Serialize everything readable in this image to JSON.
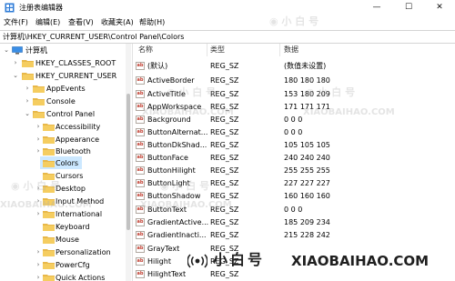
{
  "window": {
    "title": "注册表编辑器",
    "app_icon": "registry-editor-icon",
    "minimize_glyph": "—",
    "maximize_glyph": "☐",
    "close_glyph": "✕"
  },
  "menu": {
    "items": [
      "文件(F)",
      "编辑(E)",
      "查看(V)",
      "收藏夹(A)",
      "帮助(H)"
    ]
  },
  "address": {
    "path": "计算机\\HKEY_CURRENT_USER\\Control Panel\\Colors"
  },
  "tree": {
    "items": [
      {
        "label": "计算机",
        "icon": "computer-icon",
        "expanded": true
      },
      {
        "label": "HKEY_CLASSES_ROOT",
        "icon": "folder-icon",
        "expanded": false
      },
      {
        "label": "HKEY_CURRENT_USER",
        "icon": "folder-icon",
        "expanded": true
      },
      {
        "label": "AppEvents",
        "icon": "folder-icon",
        "expanded": false
      },
      {
        "label": "Console",
        "icon": "folder-icon",
        "expanded": false
      },
      {
        "label": "Control Panel",
        "icon": "folder-icon",
        "expanded": true
      },
      {
        "label": "Accessibility",
        "icon": "folder-icon",
        "expanded": false
      },
      {
        "label": "Appearance",
        "icon": "folder-icon",
        "expanded": false
      },
      {
        "label": "Bluetooth",
        "icon": "folder-icon",
        "expanded": false
      },
      {
        "label": "Colors",
        "icon": "folder-icon",
        "selected": true
      },
      {
        "label": "Cursors",
        "icon": "folder-icon",
        "expanded": false
      },
      {
        "label": "Desktop",
        "icon": "folder-icon",
        "expanded": false
      },
      {
        "label": "Input Method",
        "icon": "folder-icon",
        "expanded": false
      },
      {
        "label": "International",
        "icon": "folder-icon",
        "expanded": false
      },
      {
        "label": "Keyboard",
        "icon": "folder-icon",
        "expanded": false
      },
      {
        "label": "Mouse",
        "icon": "folder-icon",
        "expanded": false
      },
      {
        "label": "Personalization",
        "icon": "folder-icon",
        "expanded": false
      },
      {
        "label": "PowerCfg",
        "icon": "folder-icon",
        "expanded": false
      },
      {
        "label": "Quick Actions",
        "icon": "folder-icon",
        "expanded": false
      }
    ]
  },
  "list": {
    "columns": [
      "名称",
      "类型",
      "数据"
    ],
    "rows": [
      {
        "name": "(默认)",
        "type": "REG_SZ",
        "data": "(数值未设置)"
      },
      {
        "name": "ActiveBorder",
        "type": "REG_SZ",
        "data": "180 180 180"
      },
      {
        "name": "ActiveTitle",
        "type": "REG_SZ",
        "data": "153 180 209"
      },
      {
        "name": "AppWorkspace",
        "type": "REG_SZ",
        "data": "171 171 171"
      },
      {
        "name": "Background",
        "type": "REG_SZ",
        "data": "0 0 0"
      },
      {
        "name": "ButtonAlternat...",
        "type": "REG_SZ",
        "data": "0 0 0"
      },
      {
        "name": "ButtonDkShad...",
        "type": "REG_SZ",
        "data": "105 105 105"
      },
      {
        "name": "ButtonFace",
        "type": "REG_SZ",
        "data": "240 240 240"
      },
      {
        "name": "ButtonHilight",
        "type": "REG_SZ",
        "data": "255 255 255"
      },
      {
        "name": "ButtonLight",
        "type": "REG_SZ",
        "data": "227 227 227"
      },
      {
        "name": "ButtonShadow",
        "type": "REG_SZ",
        "data": "160 160 160"
      },
      {
        "name": "ButtonText",
        "type": "REG_SZ",
        "data": "0 0 0"
      },
      {
        "name": "GradientActive...",
        "type": "REG_SZ",
        "data": "185 209 234"
      },
      {
        "name": "GradientInacti...",
        "type": "REG_SZ",
        "data": "215 228 242"
      },
      {
        "name": "GrayText",
        "type": "REG_SZ",
        "data": ""
      },
      {
        "name": "Hilight",
        "type": "REG_SZ",
        "data": ""
      },
      {
        "name": "HilightText",
        "type": "REG_SZ",
        "data": ""
      }
    ]
  },
  "watermark": {
    "cn_text": "◉ 小 白 号",
    "en_text": "XIAOBAIHAO.COM",
    "brand_cn": "小白号",
    "brand_en": "XIAOBAIHAO.COM"
  },
  "colors": {
    "selection": "#cce8ff",
    "folder": "#e8b84a",
    "watermark": "#aaaaaa"
  }
}
